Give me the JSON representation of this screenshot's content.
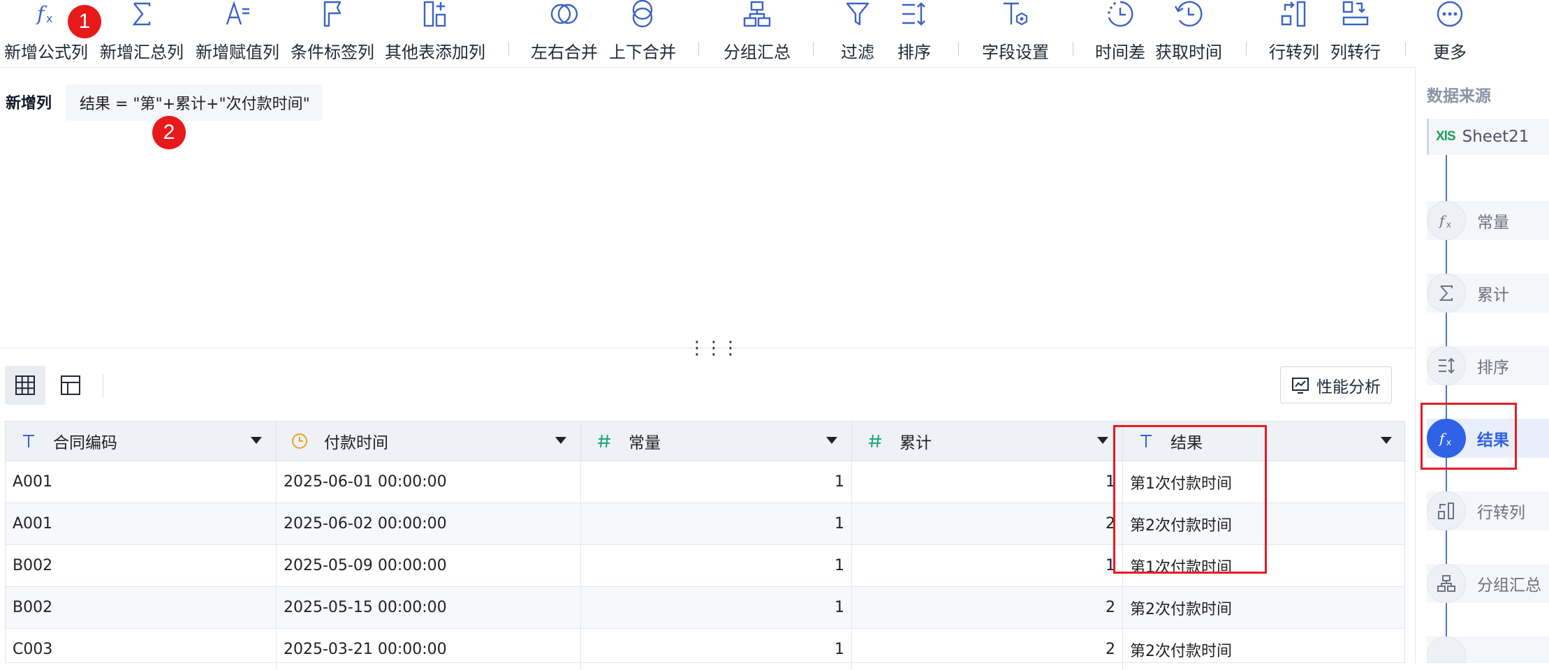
{
  "toolbar": {
    "items": [
      {
        "label": "新增公式列",
        "icon": "formula-icon"
      },
      {
        "label": "新增汇总列",
        "icon": "sigma-icon"
      },
      {
        "label": "新增赋值列",
        "icon": "assign-icon"
      },
      {
        "label": "条件标签列",
        "icon": "tag-flag-icon"
      },
      {
        "label": "其他表添加列",
        "icon": "add-column-icon"
      },
      {
        "label": "左右合并",
        "icon": "venn-horizontal-icon"
      },
      {
        "label": "上下合并",
        "icon": "venn-vertical-icon"
      },
      {
        "label": "分组汇总",
        "icon": "group-tree-icon"
      },
      {
        "label": "过滤",
        "icon": "funnel-icon"
      },
      {
        "label": "排序",
        "icon": "sort-icon"
      },
      {
        "label": "字段设置",
        "icon": "field-settings-icon"
      },
      {
        "label": "时间差",
        "icon": "clock-diff-icon"
      },
      {
        "label": "获取时间",
        "icon": "clock-get-icon"
      },
      {
        "label": "行转列",
        "icon": "row-to-col-icon"
      },
      {
        "label": "列转行",
        "icon": "col-to-row-icon"
      },
      {
        "label": "更多",
        "icon": "more-icon"
      }
    ]
  },
  "annotations": {
    "badge1": "1",
    "badge2": "2"
  },
  "editor": {
    "step_label": "新增列",
    "formula": "结果 = \"第\"+累计+\"次付款时间\""
  },
  "perf_button": "性能分析",
  "table": {
    "columns": [
      {
        "name": "合同编码",
        "type": "text"
      },
      {
        "name": "付款时间",
        "type": "datetime"
      },
      {
        "name": "常量",
        "type": "number"
      },
      {
        "name": "累计",
        "type": "number"
      },
      {
        "name": "结果",
        "type": "text"
      }
    ],
    "rows": [
      [
        "A001",
        "2025-06-01 00:00:00",
        "1",
        "1",
        "第1次付款时间"
      ],
      [
        "A001",
        "2025-06-02 00:00:00",
        "1",
        "2",
        "第2次付款时间"
      ],
      [
        "B002",
        "2025-05-09 00:00:00",
        "1",
        "1",
        "第1次付款时间"
      ],
      [
        "B002",
        "2025-05-15 00:00:00",
        "1",
        "2",
        "第2次付款时间"
      ],
      [
        "C003",
        "2025-03-21 00:00:00",
        "1",
        "2",
        "第2次付款时间"
      ]
    ]
  },
  "sidebar": {
    "title": "数据来源",
    "source": {
      "label": "Sheet21",
      "icon": "xls-icon",
      "icon_text": "XlS"
    },
    "steps": [
      {
        "label": "常量",
        "icon": "formula-icon",
        "active": false
      },
      {
        "label": "累计",
        "icon": "sigma-icon",
        "active": false
      },
      {
        "label": "排序",
        "icon": "sort-icon",
        "active": false
      },
      {
        "label": "结果",
        "icon": "formula-icon",
        "active": true
      },
      {
        "label": "行转列",
        "icon": "row-to-col-icon",
        "active": false
      },
      {
        "label": "分组汇总",
        "icon": "group-tree-icon",
        "active": false
      }
    ]
  },
  "colors": {
    "accent": "#2f62e5",
    "highlight": "#e51c23",
    "badge": "#e8191b",
    "icon": "#3a63c6"
  }
}
